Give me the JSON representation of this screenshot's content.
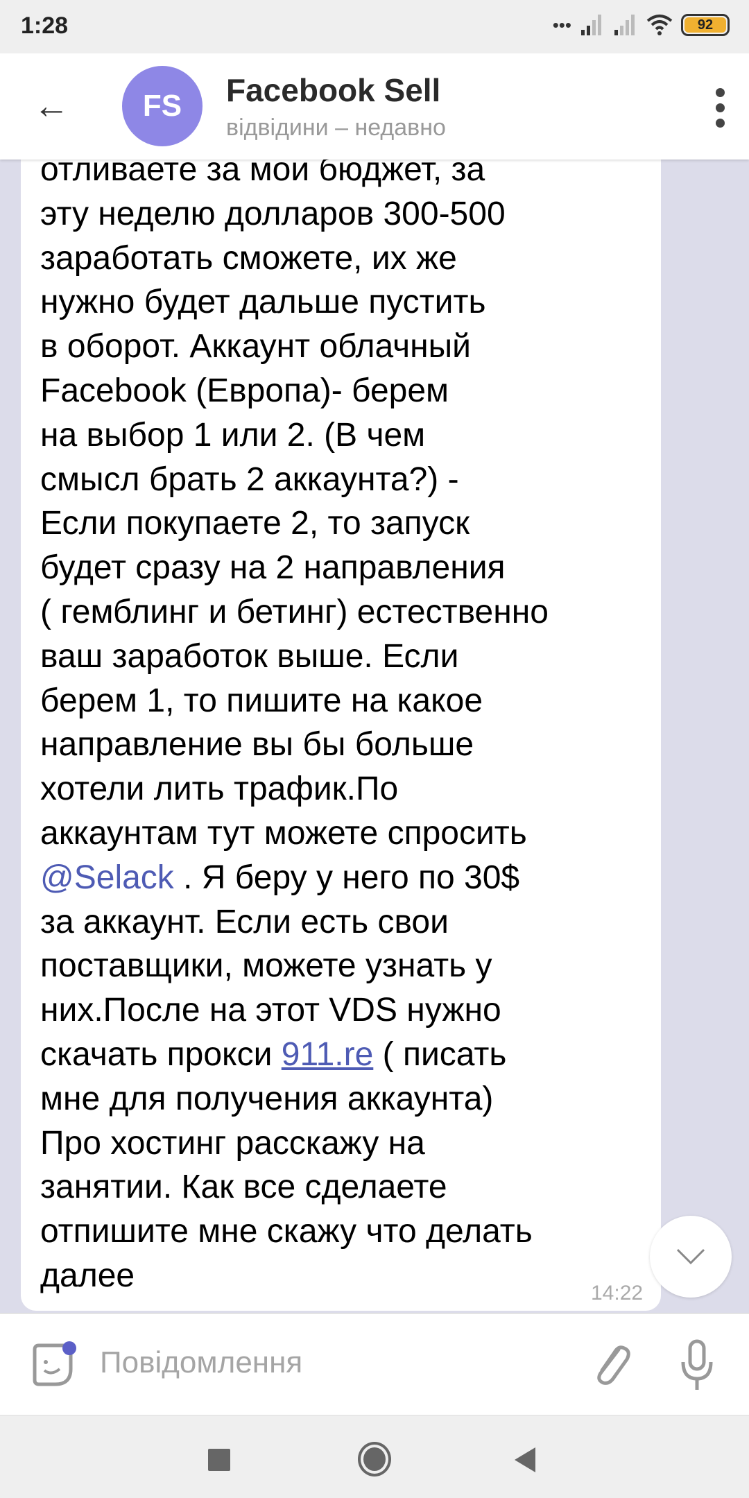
{
  "status_bar": {
    "time": "1:28",
    "battery": "92",
    "icons": [
      "dots-icon",
      "signal-icon",
      "signal-icon",
      "wifi-icon",
      "battery-icon"
    ]
  },
  "header": {
    "avatar_initials": "FS",
    "avatar_color": "#8e87e6",
    "title": "Facebook Sell",
    "subtitle": "відвідини – недавно"
  },
  "message": {
    "lines": [
      "отливаете за мои бюджет, за",
      "эту неделю долларов 300-500",
      "заработать сможете, их же",
      "нужно будет дальше пустить",
      "в оборот. Аккаунт облачный",
      "Facebook (Европа)- берем",
      "на выбор 1 или 2. (В чем",
      "смысл брать 2 аккаунта?) -",
      "Если покупаете 2, то запуск",
      "будет сразу на 2 направления",
      "( гемблинг и бетинг) естественно",
      "ваш заработок выше. Если",
      "берем 1, то пишите на какое",
      "направление вы бы больше",
      "хотели лить трафик.По",
      "аккаунтам тут можете спросить"
    ],
    "mention": "@Selack",
    "mention_rest": " . Я беру у него по 30$",
    "lines2": [
      "за аккаунт. Если есть свои",
      "поставщики, можете узнать у",
      "них.После на этот VDS нужно"
    ],
    "link_prefix": "скачать прокси ",
    "link": "911.re",
    "link_suffix": " ( писать",
    "lines3": [
      "мне для получения аккаунта)",
      "Про хостинг расскажу на",
      "занятии. Как все сделаете",
      "отпишите мне скажу что делать",
      "далее"
    ],
    "time": "14:22",
    "link_color": "#4e5bb4"
  },
  "input": {
    "placeholder": "Повідомлення"
  },
  "colors": {
    "chat_background": "#dcdcea",
    "accent": "#5b5fc7"
  }
}
